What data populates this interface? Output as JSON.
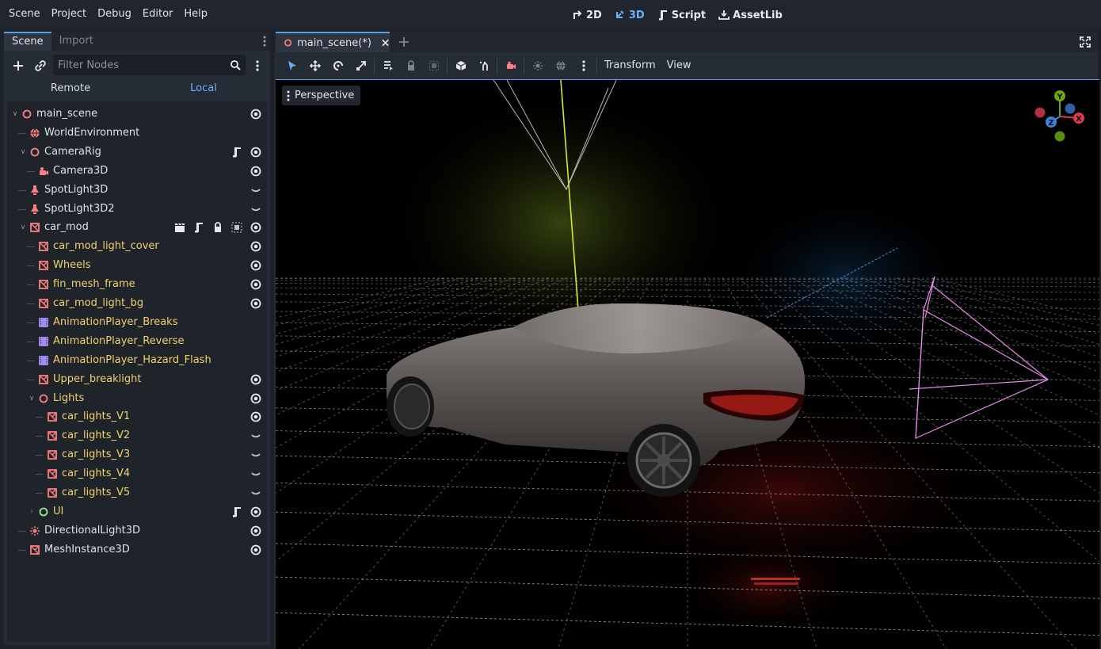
{
  "menubar": {
    "items": [
      "Scene",
      "Project",
      "Debug",
      "Editor",
      "Help"
    ],
    "workspaces": [
      {
        "label": "2D",
        "icon": "2d-icon",
        "active": false
      },
      {
        "label": "3D",
        "icon": "3d-icon",
        "active": true
      },
      {
        "label": "Script",
        "icon": "script-icon",
        "active": false
      },
      {
        "label": "AssetLib",
        "icon": "assetlib-icon",
        "active": false
      }
    ]
  },
  "scene_dock": {
    "tabs": [
      "Scene",
      "Import"
    ],
    "active_tab": "Scene",
    "filter_placeholder": "Filter Nodes",
    "remote_label": "Remote",
    "local_label": "Local",
    "tree": [
      {
        "label": "main_scene",
        "icon": "node3d-icon",
        "depth": 0,
        "expanded": true,
        "buttons": [
          "visibility-icon"
        ]
      },
      {
        "label": "WorldEnvironment",
        "icon": "world-environment-icon",
        "depth": 1,
        "buttons": []
      },
      {
        "label": "CameraRig",
        "icon": "node3d-icon",
        "depth": 1,
        "expanded": true,
        "buttons": [
          "script-icon",
          "visibility-icon"
        ]
      },
      {
        "label": "Camera3D",
        "icon": "camera-icon",
        "depth": 2,
        "buttons": [
          "visibility-icon"
        ]
      },
      {
        "label": "SpotLight3D",
        "icon": "spotlight-icon",
        "depth": 1,
        "buttons": [
          "hidden-icon"
        ]
      },
      {
        "label": "SpotLight3D2",
        "icon": "spotlight-icon",
        "depth": 1,
        "buttons": [
          "hidden-icon"
        ]
      },
      {
        "label": "car_mod",
        "icon": "mesh-icon",
        "depth": 1,
        "expanded": true,
        "buttons": [
          "clapper-icon",
          "script-icon",
          "lock-icon",
          "group-icon",
          "visibility-icon"
        ]
      },
      {
        "label": "car_mod_light_cover",
        "icon": "mesh-icon",
        "depth": 2,
        "inherited": true,
        "buttons": [
          "visibility-icon"
        ]
      },
      {
        "label": "Wheels",
        "icon": "mesh-icon",
        "depth": 2,
        "inherited": true,
        "buttons": [
          "visibility-icon"
        ]
      },
      {
        "label": "fin_mesh_frame",
        "icon": "mesh-icon",
        "depth": 2,
        "inherited": true,
        "buttons": [
          "visibility-icon"
        ]
      },
      {
        "label": "car_mod_light_bg",
        "icon": "mesh-icon",
        "depth": 2,
        "inherited": true,
        "buttons": [
          "visibility-icon"
        ]
      },
      {
        "label": "AnimationPlayer_Breaks",
        "icon": "animation-player-icon",
        "depth": 2,
        "inherited": true,
        "buttons": []
      },
      {
        "label": "AnimationPlayer_Reverse",
        "icon": "animation-player-icon",
        "depth": 2,
        "inherited": true,
        "buttons": []
      },
      {
        "label": "AnimationPlayer_Hazard_Flash",
        "icon": "animation-player-icon",
        "depth": 2,
        "inherited": true,
        "buttons": []
      },
      {
        "label": "Upper_breaklight",
        "icon": "mesh-icon",
        "depth": 2,
        "inherited": true,
        "buttons": [
          "visibility-icon"
        ]
      },
      {
        "label": "Lights",
        "icon": "node3d-icon",
        "depth": 2,
        "inherited": true,
        "expanded": true,
        "buttons": [
          "visibility-icon"
        ]
      },
      {
        "label": "car_lights_V1",
        "icon": "mesh-icon",
        "depth": 3,
        "inherited": true,
        "buttons": [
          "visibility-icon"
        ]
      },
      {
        "label": "car_lights_V2",
        "icon": "mesh-icon",
        "depth": 3,
        "inherited": true,
        "buttons": [
          "hidden-icon"
        ]
      },
      {
        "label": "car_lights_V3",
        "icon": "mesh-icon",
        "depth": 3,
        "inherited": true,
        "buttons": [
          "hidden-icon"
        ]
      },
      {
        "label": "car_lights_V4",
        "icon": "mesh-icon",
        "depth": 3,
        "inherited": true,
        "buttons": [
          "hidden-icon"
        ]
      },
      {
        "label": "car_lights_V5",
        "icon": "mesh-icon",
        "depth": 3,
        "inherited": true,
        "buttons": [
          "hidden-icon"
        ]
      },
      {
        "label": "UI",
        "icon": "control-icon",
        "depth": 2,
        "inherited": true,
        "expanded": false,
        "buttons": [
          "script-icon",
          "visibility-icon"
        ]
      },
      {
        "label": "DirectionalLight3D",
        "icon": "directional-light-icon",
        "depth": 1,
        "buttons": [
          "visibility-icon"
        ]
      },
      {
        "label": "MeshInstance3D",
        "icon": "mesh-icon",
        "depth": 1,
        "buttons": [
          "visibility-icon"
        ]
      }
    ]
  },
  "editor": {
    "scene_tab_label": "main_scene(*)",
    "toolbar_menus": [
      "Transform",
      "View"
    ],
    "tools": [
      "select-icon",
      "move-icon",
      "rotate-icon",
      "scale-icon",
      "list-select-icon",
      "lock-icon",
      "group-icon",
      "local-space-icon",
      "snap-icon",
      "camera-preview-icon",
      "sun-icon",
      "environment-icon",
      "more-icon"
    ],
    "viewport_label": "Perspective",
    "gizmo_axes": [
      "Y",
      "Z",
      "X"
    ]
  },
  "colors": {
    "accent": "#56a1ea",
    "node3d": "#fc7f7f",
    "inherited_text": "#f1d16a",
    "control": "#8eef97",
    "animation": "#a58bf4",
    "axis_x": "#e0394a",
    "axis_y": "#6ea40f",
    "axis_z": "#3a85e4"
  }
}
